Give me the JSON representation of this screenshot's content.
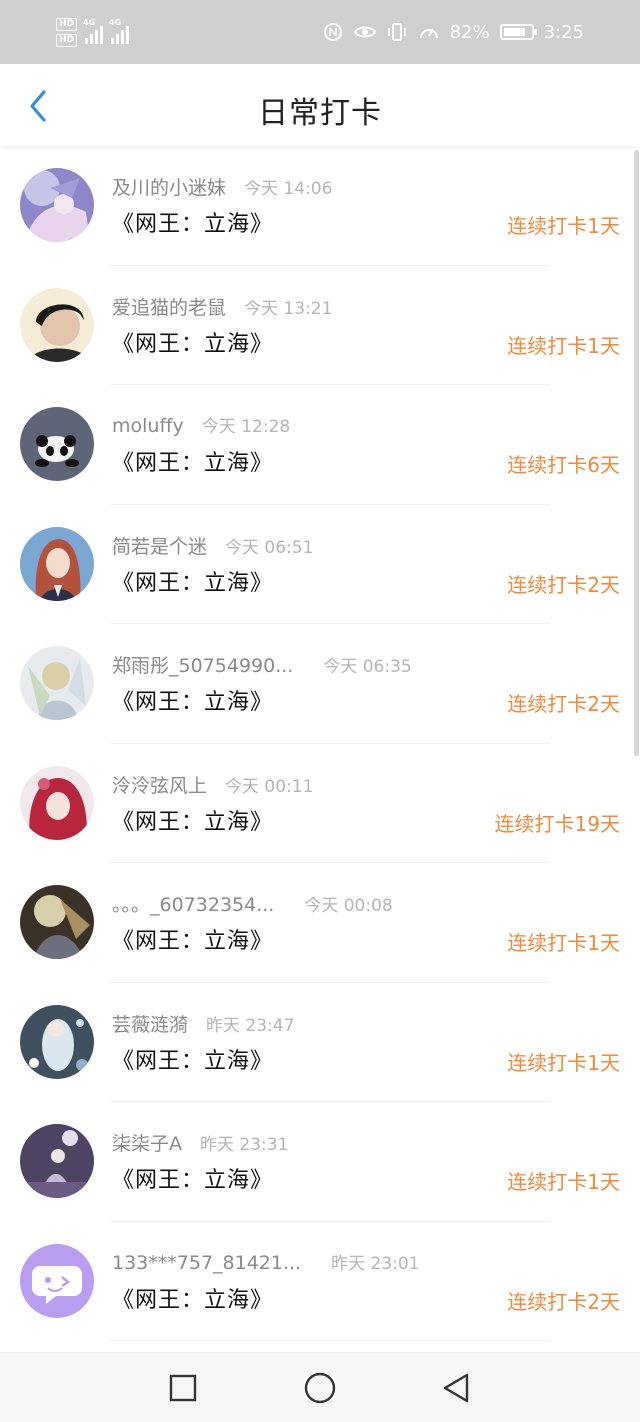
{
  "status_bar": {
    "hd1": "HD",
    "hd2": "HD",
    "net1": "4G",
    "net2": "4G",
    "battery_text": "82%",
    "battery_level": 0.82,
    "time": "3:25",
    "icons": [
      "nfc-icon",
      "eye-icon",
      "vibrate-icon",
      "speed-icon",
      "battery-icon"
    ]
  },
  "header": {
    "title": "日常打卡",
    "back_icon": "chevron-left-icon"
  },
  "accent_color": "#ee8a3a",
  "back_color": "#2f8fe0",
  "checkins": [
    {
      "username": "及川的小迷妹",
      "time": "今天 14:06",
      "book": "《网王：立海》",
      "streak": "连续打卡1天"
    },
    {
      "username": "爱追猫的老鼠",
      "time": "今天 13:21",
      "book": "《网王：立海》",
      "streak": "连续打卡1天"
    },
    {
      "username": "moluffy",
      "time": "今天 12:28",
      "book": "《网王：立海》",
      "streak": "连续打卡6天"
    },
    {
      "username": "简若是个迷",
      "time": "今天 06:51",
      "book": "《网王：立海》",
      "streak": "连续打卡2天"
    },
    {
      "username": "郑雨彤_50754990...",
      "time": "今天 06:35",
      "book": "《网王：立海》",
      "streak": "连续打卡2天"
    },
    {
      "username": "泠泠弦风上",
      "time": "今天 00:11",
      "book": "《网王：立海》",
      "streak": "连续打卡19天"
    },
    {
      "username": "。。。_60732354...",
      "time": "今天 00:08",
      "book": "《网王：立海》",
      "streak": "连续打卡1天"
    },
    {
      "username": "芸薇涟漪",
      "time": "昨天 23:47",
      "book": "《网王：立海》",
      "streak": "连续打卡1天"
    },
    {
      "username": "柒柒子A",
      "time": "昨天 23:31",
      "book": "《网王：立海》",
      "streak": "连续打卡1天"
    },
    {
      "username": "133***757_81421...",
      "time": "昨天 23:01",
      "book": "《网王：立海》",
      "streak": "连续打卡2天"
    }
  ],
  "nav_bar": {
    "buttons": [
      "recent-apps-icon",
      "home-icon",
      "back-triangle-icon"
    ]
  }
}
